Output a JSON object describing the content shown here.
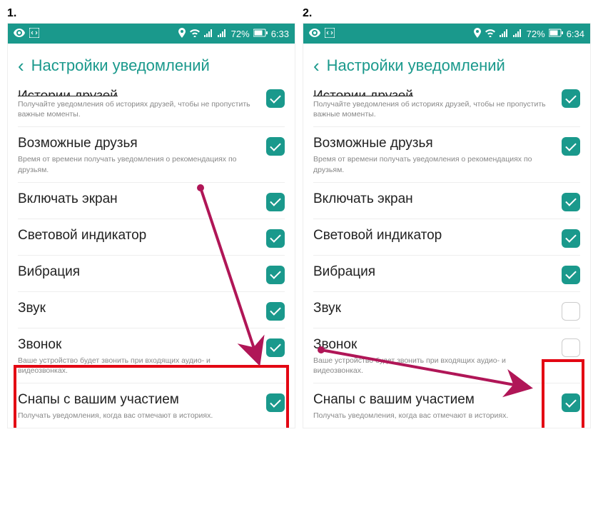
{
  "steps": [
    "1.",
    "2."
  ],
  "status": {
    "battery": "72%",
    "time1": "6:33",
    "time2": "6:34"
  },
  "header": {
    "title": "Настройки уведомлений"
  },
  "rows": {
    "stories_title": "Истории друзей",
    "stories_desc": "Получайте уведомления об историях друзей, чтобы не пропустить важные моменты.",
    "friends_title": "Возможные друзья",
    "friends_desc": "Время от времени получать уведомления о рекомендациях по друзьям.",
    "screen_title": "Включать экран",
    "led_title": "Световой индикатор",
    "vibration_title": "Вибрация",
    "sound_title": "Звук",
    "ringtone_title": "Звонок",
    "ringtone_desc": "Ваше устройство будет звонить при входящих аудио- и видеозвонках.",
    "snaps_title": "Снапы с вашим участием",
    "snaps_desc": "Получать уведомления, когда вас отмечают в историях."
  }
}
